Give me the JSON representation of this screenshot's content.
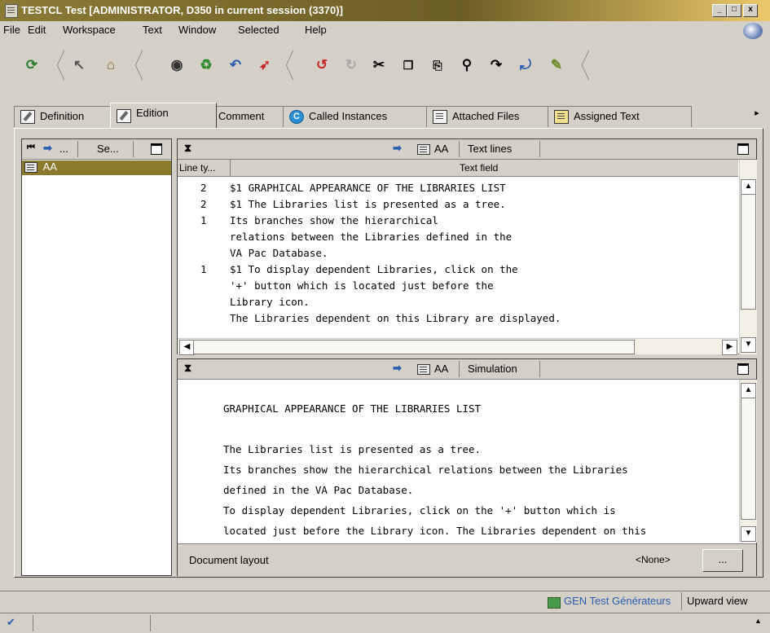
{
  "window": {
    "title": "TESTCL Test [ADMINISTRATOR, D350 in current session (3370)]",
    "controls": {
      "minimize": "_",
      "maximize": "□",
      "close": "x"
    }
  },
  "menu": {
    "file": "File",
    "edit": "Edit",
    "workspace": "Workspace",
    "text": "Text",
    "window": "Window",
    "selected": "Selected",
    "help": "Help"
  },
  "toolbar": {
    "buttons": [
      "refresh",
      "pointer",
      "home",
      "save-disk",
      "synchronize",
      "undo-back",
      "jump",
      "undo",
      "redo",
      "cut",
      "copy",
      "paste",
      "find",
      "goto-line",
      "wrap",
      "spell"
    ]
  },
  "tabs": {
    "definition": "Definition",
    "edition": "Edition",
    "comment": "Comment",
    "called_instances": "Called Instances",
    "attached_files": "Attached Files",
    "assigned_text": "Assigned Text",
    "scroll_right": "▸"
  },
  "left_panel": {
    "header_label": "Se...",
    "header_arrow_label": "...",
    "selected_item": "AA"
  },
  "text_lines_panel": {
    "header_entity": "AA",
    "header_title": "Text lines",
    "columns": {
      "line_type": "Line ty...",
      "text_field": "Text field"
    },
    "rows": [
      {
        "type": "2",
        "text": "$1 GRAPHICAL APPEARANCE OF THE LIBRARIES LIST"
      },
      {
        "type": "2",
        "text": "$1 The Libraries list is presented as a tree."
      },
      {
        "type": "1",
        "text": "Its branches show the hierarchical"
      },
      {
        "type": "",
        "text": "relations between the Libraries defined in the"
      },
      {
        "type": "",
        "text": "VA Pac Database."
      },
      {
        "type": "1",
        "text": "$1 To display dependent Libraries, click on the"
      },
      {
        "type": "",
        "text": "'+' button which is located just before the"
      },
      {
        "type": "",
        "text": "Library icon."
      },
      {
        "type": "",
        "text": "The Libraries dependent on this Library are displayed."
      }
    ]
  },
  "simulation_panel": {
    "header_entity": "AA",
    "header_title": "Simulation",
    "lines": [
      "GRAPHICAL APPEARANCE OF THE LIBRARIES LIST",
      "",
      "The Libraries list is presented as a tree.",
      "Its branches show the hierarchical relations between the Libraries",
      "defined in the VA Pac Database.",
      "To display dependent Libraries, click on the '+' button which is",
      "located just before the Library icon. The Libraries dependent on this"
    ],
    "document_layout_label": "Document layout",
    "document_layout_value": "<None>",
    "browse_button": "..."
  },
  "status": {
    "generator_label": "GEN Test Générateurs",
    "upward_view": "Upward view",
    "check": "✔"
  },
  "colors": {
    "title_bar": "#8b7a36",
    "selection": "#8c7a2c",
    "link_blue": "#2a5db0"
  }
}
